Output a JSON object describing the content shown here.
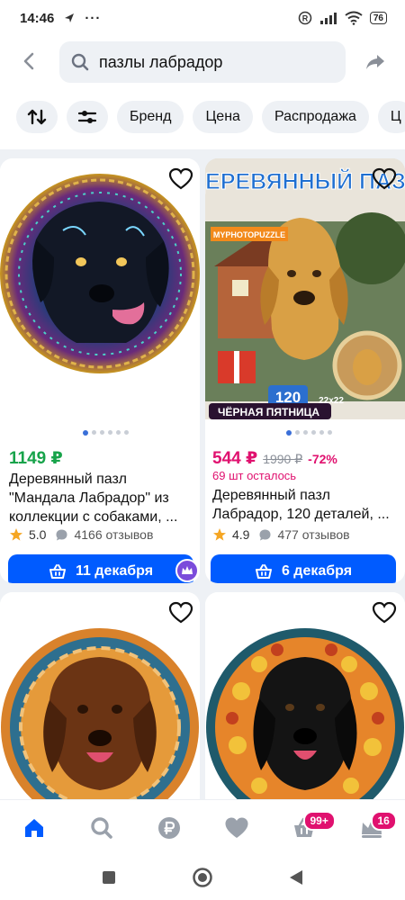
{
  "status_bar": {
    "time": "14:46",
    "battery": "76"
  },
  "search": {
    "query": "пазлы лабрадор"
  },
  "filters": [
    "Бренд",
    "Цена",
    "Распродажа",
    "Ц"
  ],
  "products": [
    {
      "price": "1149 ₽",
      "title_line1": "Деревянный пазл",
      "title_line2": "\"Мандала Лабрадор\" из",
      "title_line3": "коллекции с собаками, ...",
      "rating": "5.0",
      "reviews": "4166 отзывов",
      "delivery": "11 декабря"
    },
    {
      "image_title": "ДЕРЕВЯННЫЙ ПАЗЛ",
      "image_brand": "MYPHOTOPUZZLE",
      "image_count": "120",
      "image_size": "22x22",
      "image_promo": "ЧЁРНАЯ ПЯТНИЦА",
      "price": "544 ₽",
      "old_price": "1990 ₽",
      "discount": "-72%",
      "stock": "69 шт осталось",
      "title_line1": "Деревянный пазл",
      "title_line2": "Лабрадор, 120 деталей, ...",
      "rating": "4.9",
      "reviews": "477 отзывов",
      "delivery": "6 декабря"
    }
  ],
  "bottom_nav": {
    "cart_badge": "99+",
    "profile_badge": "16"
  },
  "colors": {
    "accent": "#005bff",
    "price_green": "#17a34a",
    "sale_pink": "#e0116f"
  }
}
